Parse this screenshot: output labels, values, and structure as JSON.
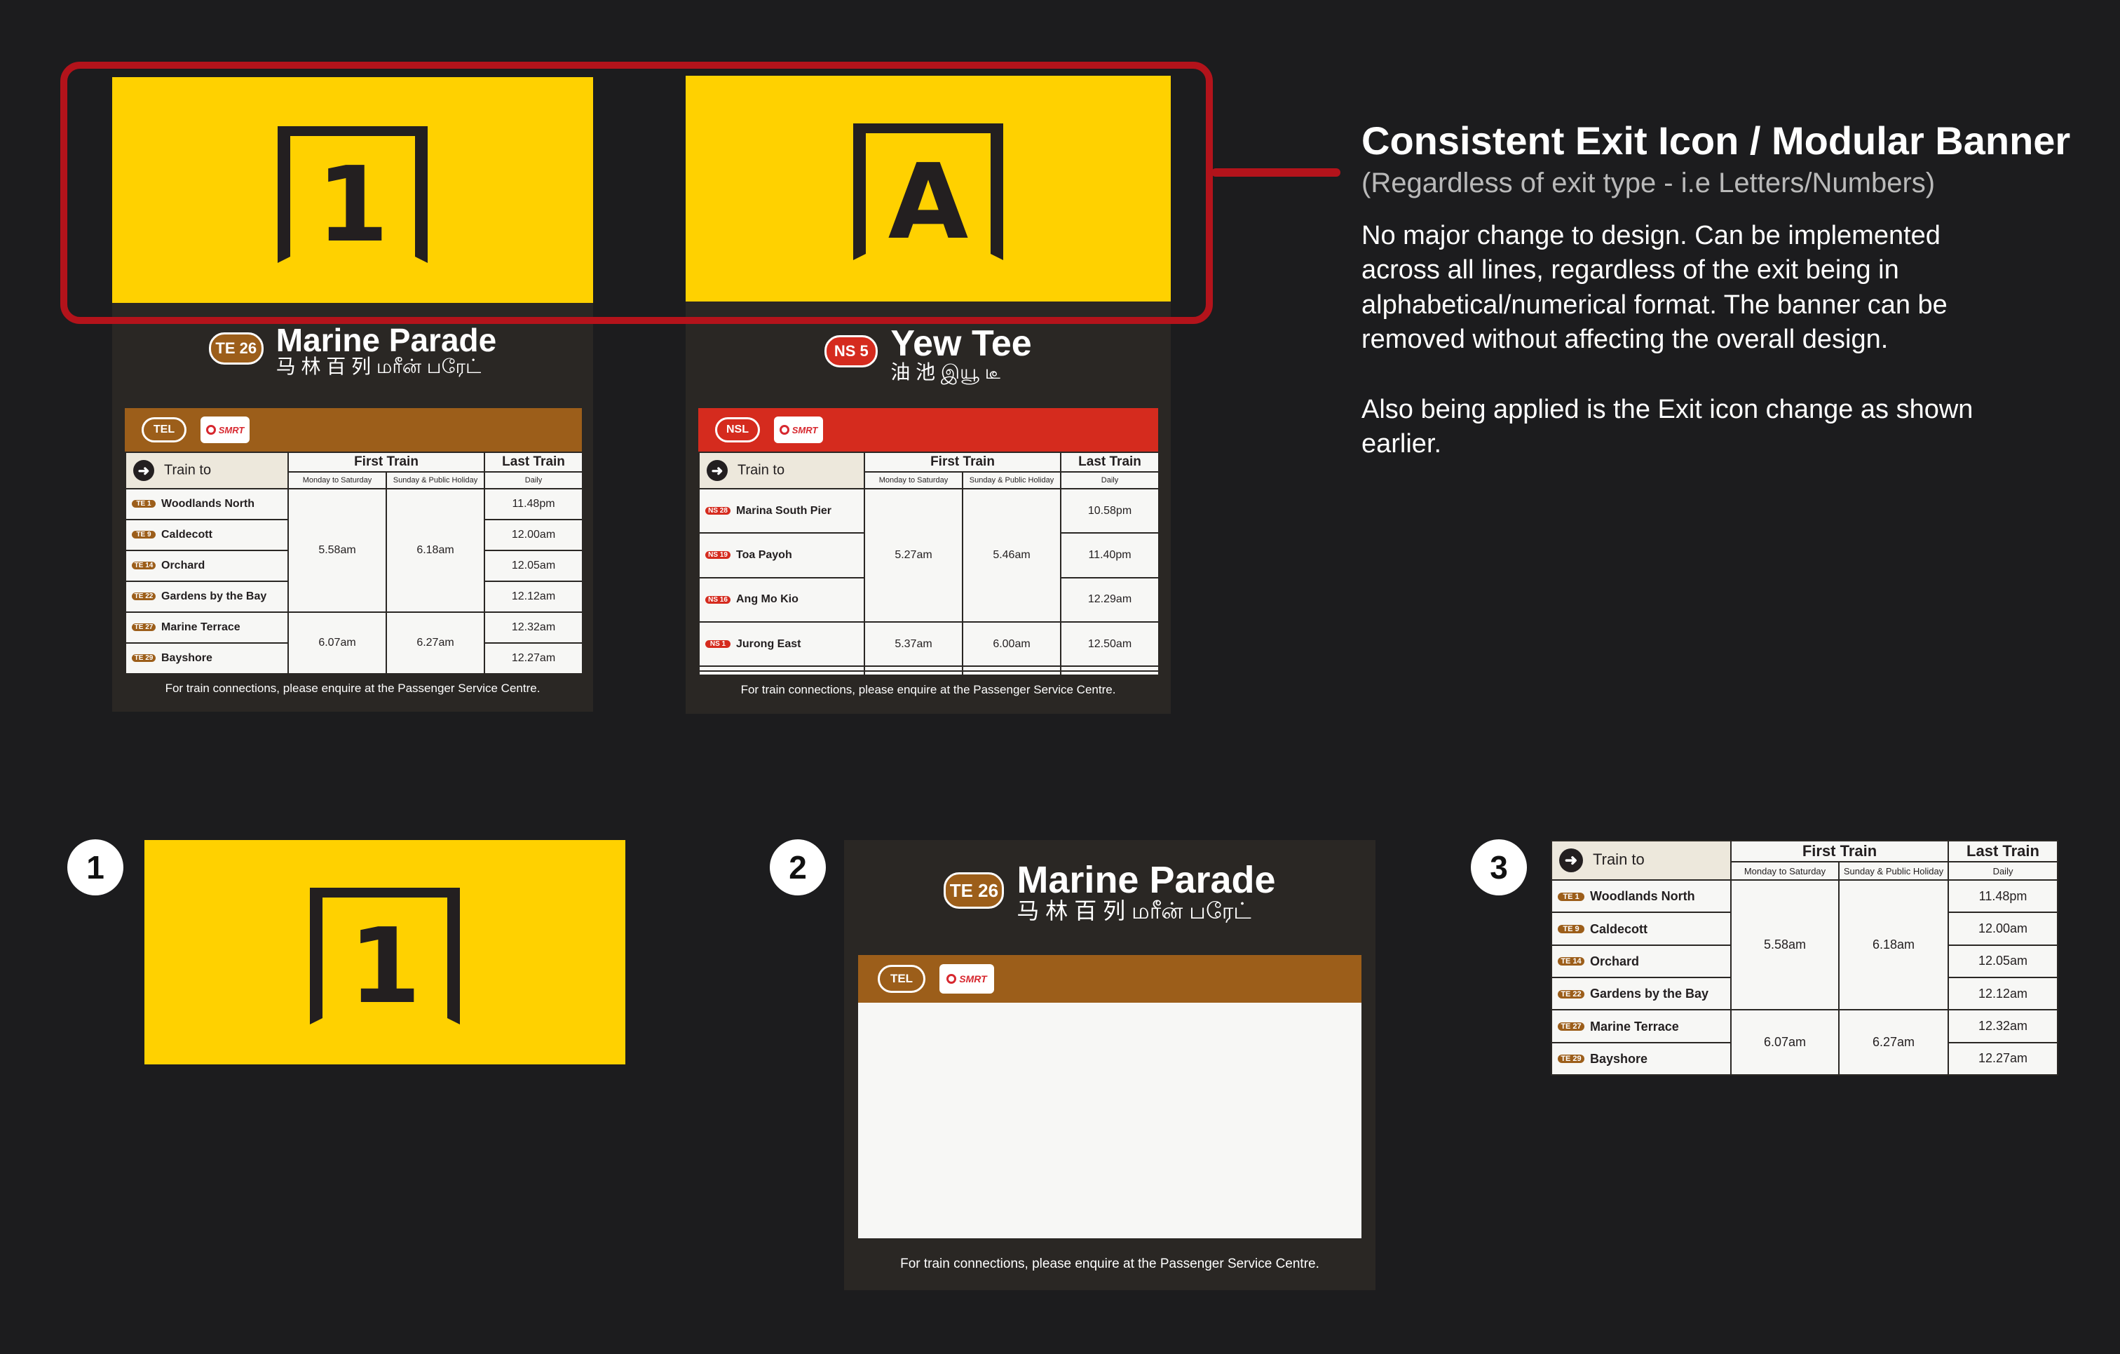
{
  "colors": {
    "background": "#1c1c1e",
    "exit_yellow": "#ffd100",
    "tel_brown": "#9c5e1a",
    "nsl_red": "#d52b1e",
    "highlight_red": "#b3131b",
    "panel_dark": "#2a2724"
  },
  "signs": [
    {
      "exit_label": "1",
      "station_code": "TE 26",
      "station_name": "Marine Parade",
      "station_sub": "马 林 百 列   மரீன் பரேட்",
      "line_label": "TEL",
      "operator": "SMRT",
      "header": {
        "train_to": "Train to",
        "first_train": "First Train",
        "last_train": "Last Train",
        "weekday": "Monday to Saturday",
        "sunday": "Sunday & Public Holiday",
        "daily": "Daily"
      },
      "rows": [
        {
          "code": "TE 1",
          "dest": "Woodlands North",
          "last": "11.48pm"
        },
        {
          "code": "TE 9",
          "dest": "Caldecott",
          "last": "12.00am"
        },
        {
          "code": "TE 14",
          "dest": "Orchard",
          "last": "12.05am"
        },
        {
          "code": "TE 22",
          "dest": "Gardens by the Bay",
          "last": "12.12am"
        },
        {
          "code": "TE 27",
          "dest": "Marine Terrace",
          "last": "12.32am"
        },
        {
          "code": "TE 29",
          "dest": "Bayshore",
          "last": "12.27am"
        }
      ],
      "groups": [
        {
          "weekday": "5.58am",
          "sunday": "6.18am"
        },
        {
          "weekday": "6.07am",
          "sunday": "6.27am"
        }
      ],
      "footer": "For train connections, please enquire at the Passenger Service Centre."
    },
    {
      "exit_label": "A",
      "station_code": "NS 5",
      "station_name": "Yew Tee",
      "station_sub": "油 池   இயூ டீ",
      "line_label": "NSL",
      "operator": "SMRT",
      "header": {
        "train_to": "Train to",
        "first_train": "First Train",
        "last_train": "Last Train",
        "weekday": "Monday to Saturday",
        "sunday": "Sunday & Public Holiday",
        "daily": "Daily"
      },
      "rows": [
        {
          "code": "NS 28",
          "dest": "Marina South Pier",
          "last": "10.58pm"
        },
        {
          "code": "NS 19",
          "dest": "Toa Payoh",
          "last": "11.40pm"
        },
        {
          "code": "NS 16",
          "dest": "Ang Mo Kio",
          "last": "12.29am"
        },
        {
          "code": "NS 1",
          "dest": "Jurong East",
          "last": "12.50am"
        }
      ],
      "groups": [
        {
          "weekday": "5.27am",
          "sunday": "5.46am"
        },
        {
          "weekday": "5.37am",
          "sunday": "6.00am"
        }
      ],
      "footer": "For train connections, please enquire at the Passenger Service Centre."
    }
  ],
  "notes": {
    "title": "Consistent Exit Icon / Modular Banner",
    "subtitle": "(Regardless of exit type - i.e Letters/Numbers)",
    "body1": "No major change to design. Can be implemented across all lines, regardless of the exit being in alphabetical/numerical format. The banner can be removed without affecting the overall design.",
    "body2": "Also being applied is the Exit icon change as shown earlier."
  },
  "modules": {
    "step1": "1",
    "step2": "2",
    "step3": "3",
    "exit_label": "1",
    "station_code": "TE 26",
    "station_name": "Marine Parade",
    "station_sub": "马 林 百 列   மரீன் பரேட்",
    "line_label": "TEL",
    "operator": "SMRT",
    "footer": "For train connections, please enquire at the Passenger Service Centre."
  }
}
